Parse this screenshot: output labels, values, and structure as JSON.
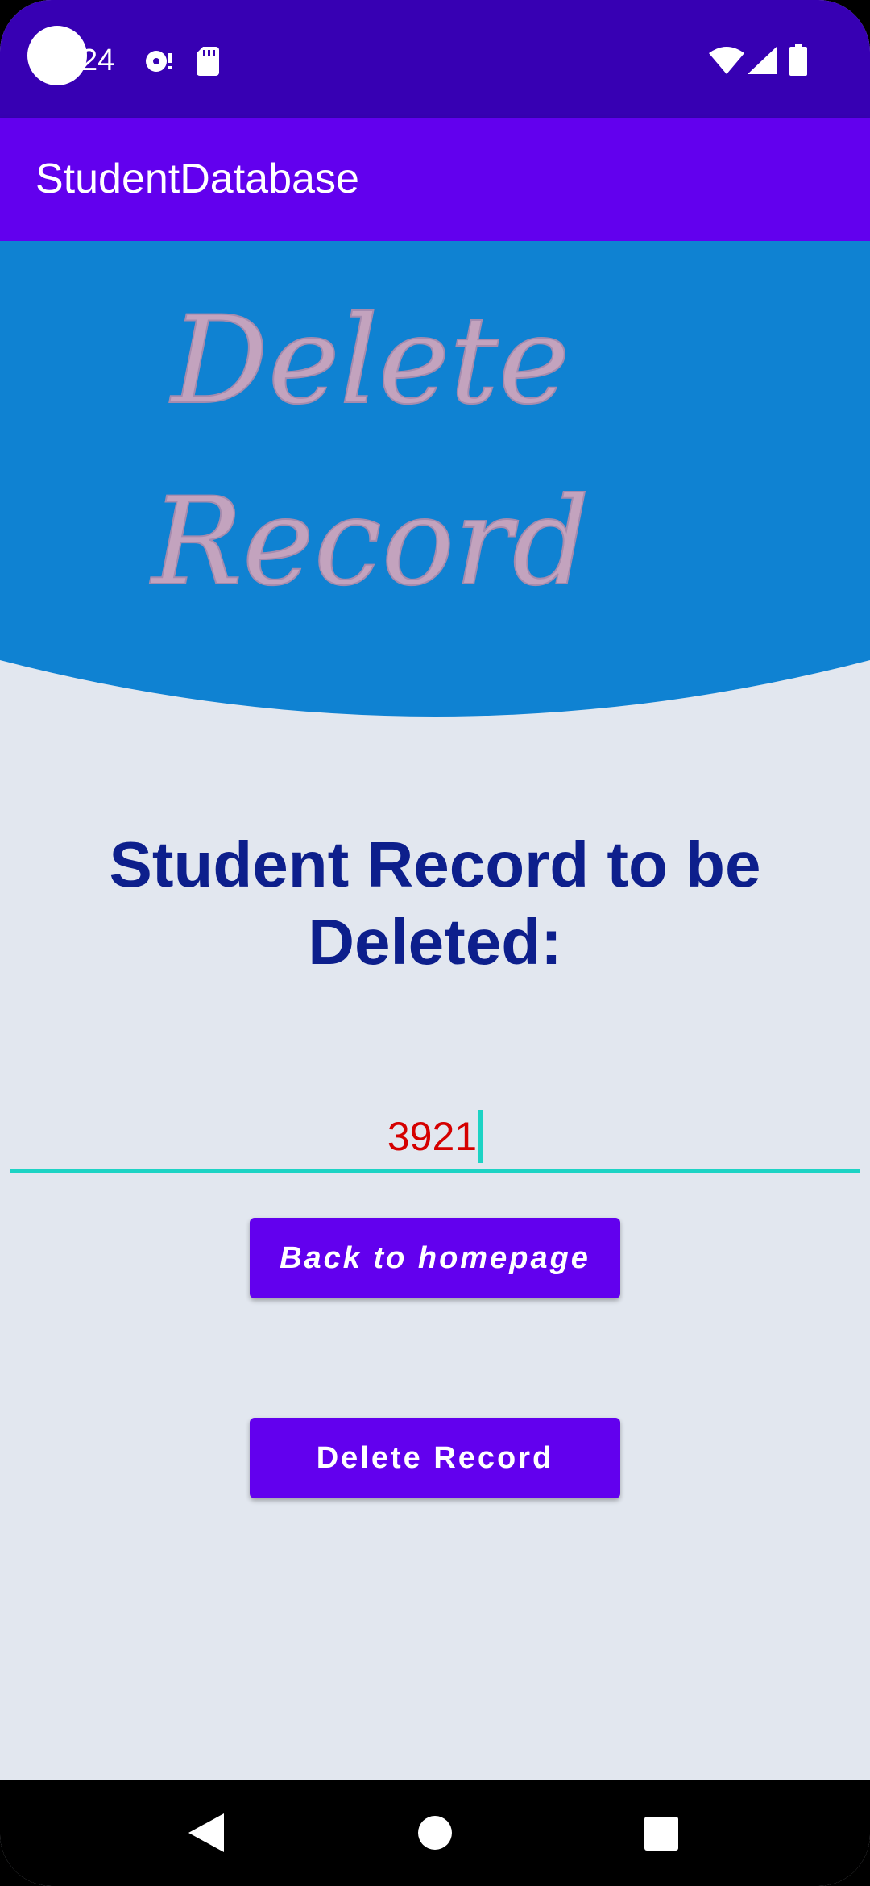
{
  "status_bar": {
    "time": "24",
    "icons": [
      "camera-cutout",
      "media-icon",
      "sd-card-icon",
      "wifi-icon",
      "signal-icon",
      "battery-icon"
    ]
  },
  "app_bar": {
    "title": "StudentDatabase"
  },
  "header": {
    "title_line1": "Delete",
    "title_line2": "Record"
  },
  "main": {
    "heading": "Student Record to be Deleted:",
    "student_id_value": "3921",
    "back_button_label": "Back to homepage",
    "delete_button_label": "Delete Record"
  },
  "nav_bar": {
    "icons": [
      "back-icon",
      "home-icon",
      "recents-icon"
    ]
  },
  "colors": {
    "status_bar": "#3700B3",
    "app_bar": "#6200EE",
    "header_band": "#0F82D2",
    "background": "#E2E7EF",
    "heading": "#0D1F8C",
    "input_text": "#D50000",
    "input_underline": "#1DD3C4",
    "button": "#6200EE",
    "header_script": "#C3A3BE"
  }
}
